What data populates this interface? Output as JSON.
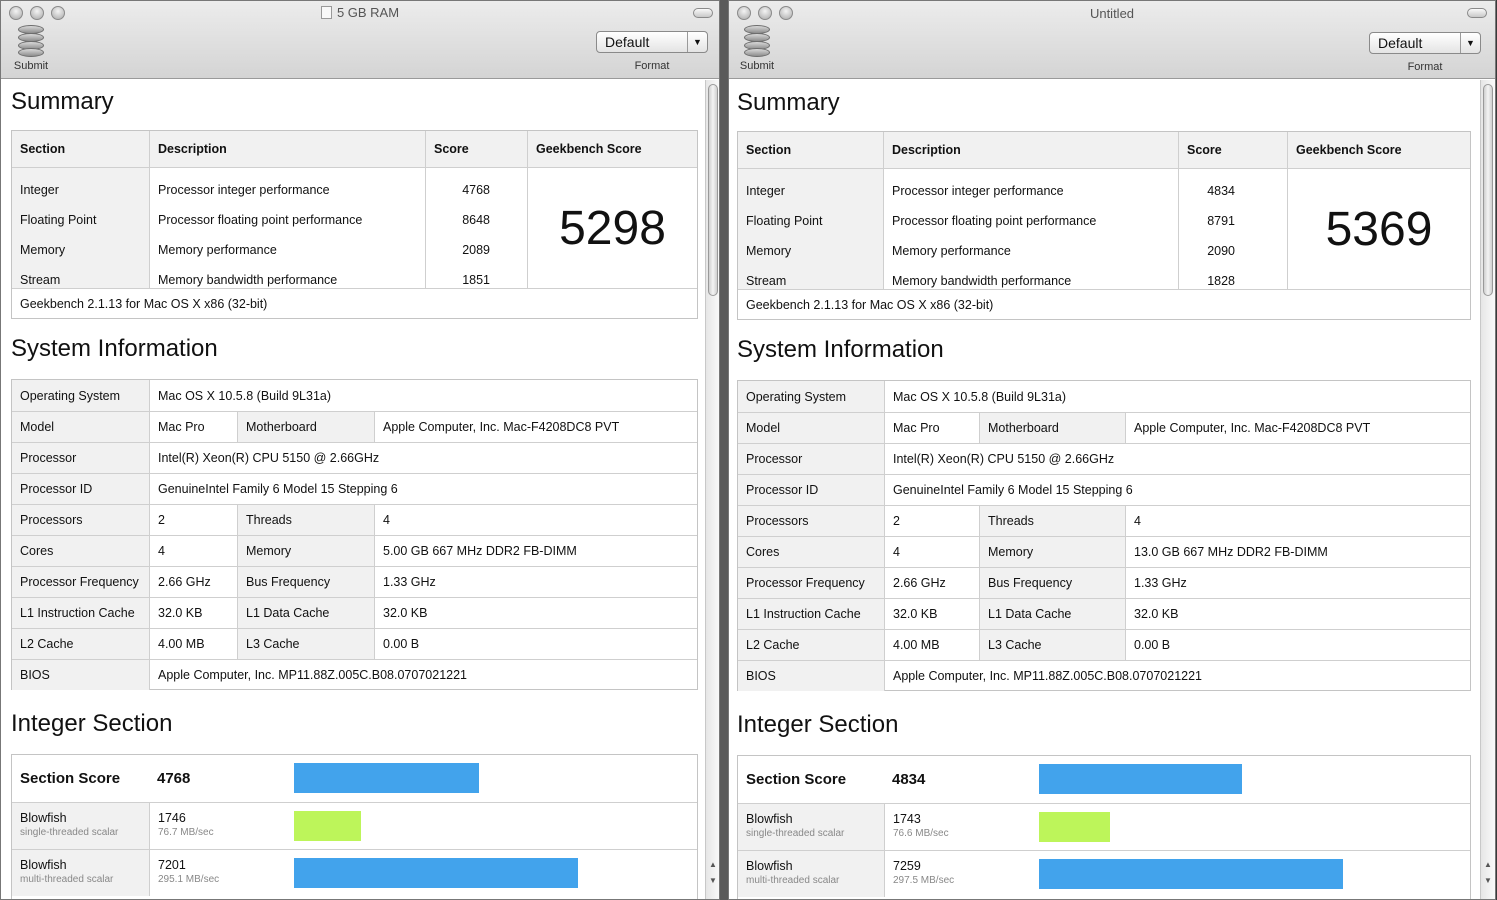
{
  "left": {
    "title": "5 GB RAM",
    "submit_label": "Submit",
    "format_value": "Default",
    "format_label": "Format",
    "summary_heading": "Summary",
    "summary_headers": [
      "Section",
      "Description",
      "Score",
      "Geekbench Score"
    ],
    "summary_rows": [
      {
        "section": "Integer",
        "description": "Processor integer performance",
        "score": "4768"
      },
      {
        "section": "Floating Point",
        "description": "Processor floating point performance",
        "score": "8648"
      },
      {
        "section": "Memory",
        "description": "Memory performance",
        "score": "2089"
      },
      {
        "section": "Stream",
        "description": "Memory bandwidth performance",
        "score": "1851"
      }
    ],
    "geekbench_score": "5298",
    "version": "Geekbench 2.1.13 for Mac OS X x86 (32-bit)",
    "sysinfo_heading": "System Information",
    "os_label": "Operating System",
    "os_value": "Mac OS X 10.5.8 (Build 9L31a)",
    "model_label": "Model",
    "model_value": "Mac Pro",
    "motherboard_label": "Motherboard",
    "motherboard_value": "Apple Computer, Inc. Mac-F4208DC8 PVT",
    "processor_label": "Processor",
    "processor_value": "Intel(R) Xeon(R) CPU 5150 @ 2.66GHz",
    "procid_label": "Processor ID",
    "procid_value": "GenuineIntel Family 6 Model 15 Stepping 6",
    "processors_label": "Processors",
    "processors_value": "2",
    "threads_label": "Threads",
    "threads_value": "4",
    "cores_label": "Cores",
    "cores_value": "4",
    "memory_label": "Memory",
    "memory_value": "5.00 GB  667 MHz DDR2 FB-DIMM",
    "freq_label": "Processor Frequency",
    "freq_value": "2.66 GHz",
    "bus_label": "Bus Frequency",
    "bus_value": "1.33 GHz",
    "l1i_label": "L1 Instruction Cache",
    "l1i_value": "32.0 KB",
    "l1d_label": "L1 Data Cache",
    "l1d_value": "32.0 KB",
    "l2_label": "L2 Cache",
    "l2_value": "4.00 MB",
    "l3_label": "L3 Cache",
    "l3_value": "0.00 B",
    "bios_label": "BIOS",
    "bios_value": "Apple Computer, Inc. MP11.88Z.005C.B08.0707021221",
    "integer_heading": "Integer Section",
    "section_score_label": "Section Score",
    "section_score": "4768",
    "tests": [
      {
        "name": "Blowfish",
        "mode": "single-threaded scalar",
        "score": "1746",
        "rate": "76.7 MB/sec"
      },
      {
        "name": "Blowfish",
        "mode": "multi-threaded scalar",
        "score": "7201",
        "rate": "295.1 MB/sec"
      }
    ]
  },
  "right": {
    "title": "Untitled",
    "submit_label": "Submit",
    "format_value": "Default",
    "format_label": "Format",
    "summary_heading": "Summary",
    "summary_headers": [
      "Section",
      "Description",
      "Score",
      "Geekbench Score"
    ],
    "summary_rows": [
      {
        "section": "Integer",
        "description": "Processor integer performance",
        "score": "4834"
      },
      {
        "section": "Floating Point",
        "description": "Processor floating point performance",
        "score": "8791"
      },
      {
        "section": "Memory",
        "description": "Memory performance",
        "score": "2090"
      },
      {
        "section": "Stream",
        "description": "Memory bandwidth performance",
        "score": "1828"
      }
    ],
    "geekbench_score": "5369",
    "version": "Geekbench 2.1.13 for Mac OS X x86 (32-bit)",
    "sysinfo_heading": "System Information",
    "os_label": "Operating System",
    "os_value": "Mac OS X 10.5.8 (Build 9L31a)",
    "model_label": "Model",
    "model_value": "Mac Pro",
    "motherboard_label": "Motherboard",
    "motherboard_value": "Apple Computer, Inc. Mac-F4208DC8 PVT",
    "processor_label": "Processor",
    "processor_value": "Intel(R) Xeon(R) CPU 5150 @ 2.66GHz",
    "procid_label": "Processor ID",
    "procid_value": "GenuineIntel Family 6 Model 15 Stepping 6",
    "processors_label": "Processors",
    "processors_value": "2",
    "threads_label": "Threads",
    "threads_value": "4",
    "cores_label": "Cores",
    "cores_value": "4",
    "memory_label": "Memory",
    "memory_value": "13.0 GB  667 MHz DDR2 FB-DIMM",
    "freq_label": "Processor Frequency",
    "freq_value": "2.66 GHz",
    "bus_label": "Bus Frequency",
    "bus_value": "1.33 GHz",
    "l1i_label": "L1 Instruction Cache",
    "l1i_value": "32.0 KB",
    "l1d_label": "L1 Data Cache",
    "l1d_value": "32.0 KB",
    "l2_label": "L2 Cache",
    "l2_value": "4.00 MB",
    "l3_label": "L3 Cache",
    "l3_value": "0.00 B",
    "bios_label": "BIOS",
    "bios_value": "Apple Computer, Inc. MP11.88Z.005C.B08.0707021221",
    "integer_heading": "Integer Section",
    "section_score_label": "Section Score",
    "section_score": "4834",
    "tests": [
      {
        "name": "Blowfish",
        "mode": "single-threaded scalar",
        "score": "1743",
        "rate": "76.6 MB/sec"
      },
      {
        "name": "Blowfish",
        "mode": "multi-threaded scalar",
        "score": "7259",
        "rate": "297.5 MB/sec"
      }
    ]
  },
  "colors": {
    "bar_multi": "#42a3ec",
    "bar_single": "#bdf55a"
  }
}
